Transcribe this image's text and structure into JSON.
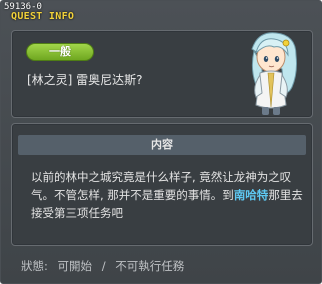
{
  "window": {
    "quest_id": "59136-0",
    "title": "QUEST INFO"
  },
  "quest": {
    "category_badge": "一般",
    "name": "[林之灵] 雷奥尼达斯?"
  },
  "npc": {
    "icon": "npc-portrait-icon"
  },
  "content": {
    "header": "内容",
    "description_part1": "以前的林中之城究竟是什么样子, 竟然让龙神为之叹气。不管怎样, 那并不是重要的事情。到",
    "highlight_name": "南哈特",
    "description_part2": "那里去接受第三项任务吧"
  },
  "status": {
    "label": "狀態:",
    "value_1": "可開始",
    "separator": "/",
    "value_2": "不可執行任務"
  },
  "colors": {
    "title": "#f2d23a",
    "badge": "#8cc63a",
    "highlight": "#5ec8f2",
    "window_bg": "#3f4448"
  }
}
